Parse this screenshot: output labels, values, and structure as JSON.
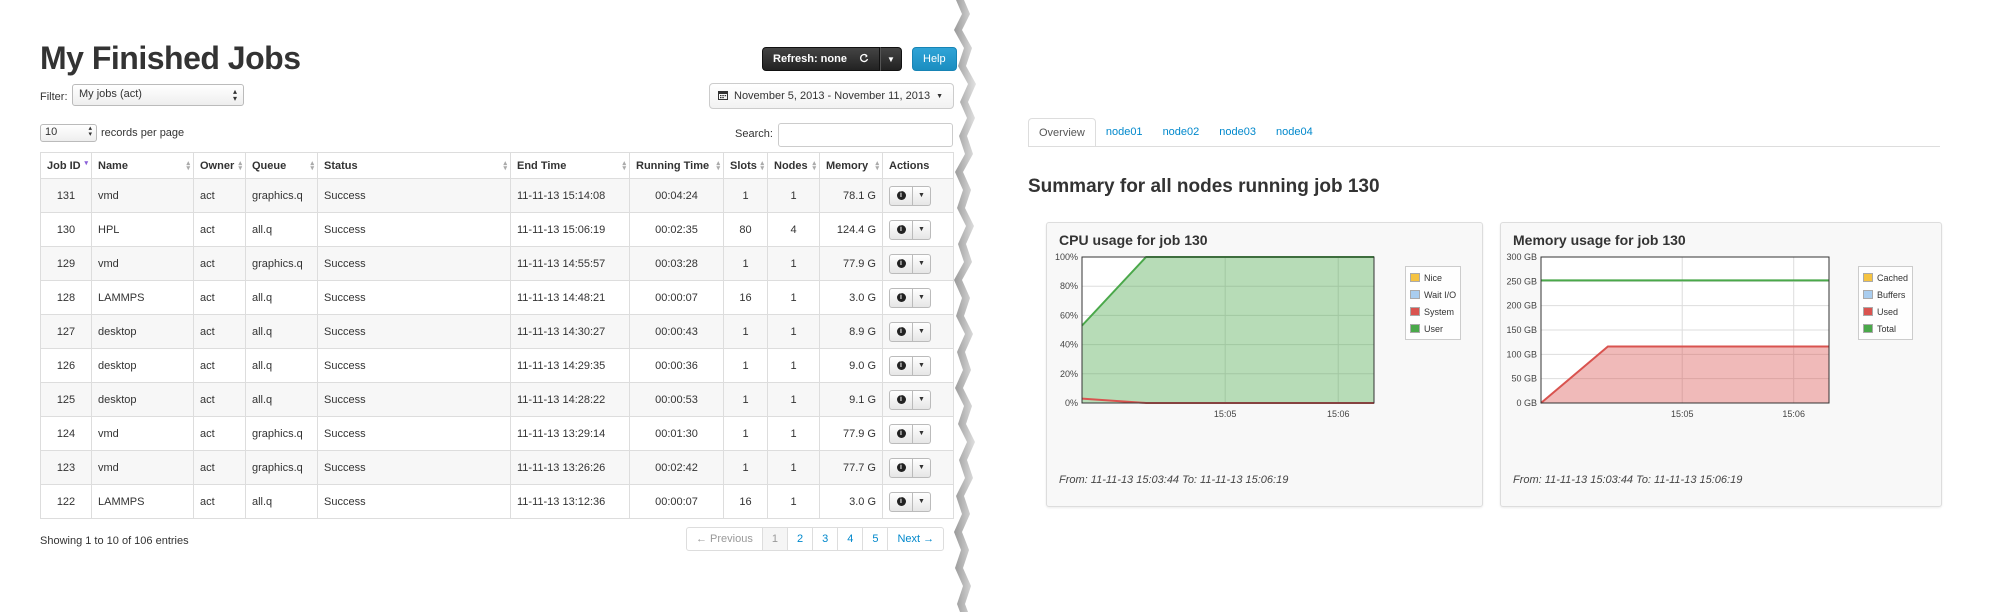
{
  "left": {
    "title": "My Finished Jobs",
    "refresh_label": "Refresh: none",
    "refresh_icon": "refresh-icon",
    "help_label": "Help",
    "filter_label": "Filter:",
    "filter_value": "My jobs (act)",
    "date_range": "November 5, 2013 - November 11, 2013",
    "per_page_value": "10",
    "per_page_label": "records per page",
    "search_label": "Search:",
    "search_value": "",
    "columns": [
      "Job ID",
      "Name",
      "Owner",
      "Queue",
      "Status",
      "End Time",
      "Running Time",
      "Slots",
      "Nodes",
      "Memory",
      "Actions"
    ],
    "rows": [
      {
        "id": "131",
        "name": "vmd",
        "owner": "act",
        "queue": "graphics.q",
        "status": "Success",
        "end": "11-11-13 15:14:08",
        "run": "00:04:24",
        "slots": "1",
        "nodes": "1",
        "mem": "78.1 G"
      },
      {
        "id": "130",
        "name": "HPL",
        "owner": "act",
        "queue": "all.q",
        "status": "Success",
        "end": "11-11-13 15:06:19",
        "run": "00:02:35",
        "slots": "80",
        "nodes": "4",
        "mem": "124.4 G"
      },
      {
        "id": "129",
        "name": "vmd",
        "owner": "act",
        "queue": "graphics.q",
        "status": "Success",
        "end": "11-11-13 14:55:57",
        "run": "00:03:28",
        "slots": "1",
        "nodes": "1",
        "mem": "77.9 G"
      },
      {
        "id": "128",
        "name": "LAMMPS",
        "owner": "act",
        "queue": "all.q",
        "status": "Success",
        "end": "11-11-13 14:48:21",
        "run": "00:00:07",
        "slots": "16",
        "nodes": "1",
        "mem": "3.0 G"
      },
      {
        "id": "127",
        "name": "desktop",
        "owner": "act",
        "queue": "all.q",
        "status": "Success",
        "end": "11-11-13 14:30:27",
        "run": "00:00:43",
        "slots": "1",
        "nodes": "1",
        "mem": "8.9 G"
      },
      {
        "id": "126",
        "name": "desktop",
        "owner": "act",
        "queue": "all.q",
        "status": "Success",
        "end": "11-11-13 14:29:35",
        "run": "00:00:36",
        "slots": "1",
        "nodes": "1",
        "mem": "9.0 G"
      },
      {
        "id": "125",
        "name": "desktop",
        "owner": "act",
        "queue": "all.q",
        "status": "Success",
        "end": "11-11-13 14:28:22",
        "run": "00:00:53",
        "slots": "1",
        "nodes": "1",
        "mem": "9.1 G"
      },
      {
        "id": "124",
        "name": "vmd",
        "owner": "act",
        "queue": "graphics.q",
        "status": "Success",
        "end": "11-11-13 13:29:14",
        "run": "00:01:30",
        "slots": "1",
        "nodes": "1",
        "mem": "77.9 G"
      },
      {
        "id": "123",
        "name": "vmd",
        "owner": "act",
        "queue": "graphics.q",
        "status": "Success",
        "end": "11-11-13 13:26:26",
        "run": "00:02:42",
        "slots": "1",
        "nodes": "1",
        "mem": "77.7 G"
      },
      {
        "id": "122",
        "name": "LAMMPS",
        "owner": "act",
        "queue": "all.q",
        "status": "Success",
        "end": "11-11-13 13:12:36",
        "run": "00:00:07",
        "slots": "16",
        "nodes": "1",
        "mem": "3.0 G"
      }
    ],
    "showing": "Showing 1 to 10 of 106 entries",
    "pager": [
      "← Previous",
      "1",
      "2",
      "3",
      "4",
      "5",
      "Next →"
    ]
  },
  "right": {
    "tabs": [
      "Overview",
      "node01",
      "node02",
      "node03",
      "node04"
    ],
    "summary_title": "Summary for all nodes running job 130",
    "cpu_title": "CPU usage for job 130",
    "cpu_from": "From: 11-11-13 15:03:44 To: 11-11-13 15:06:19",
    "mem_title": "Memory usage for job 130",
    "mem_from": "From: 11-11-13 15:03:44 To: 11-11-13 15:06:19"
  },
  "chart_data": [
    {
      "type": "area",
      "title": "CPU usage for job 130",
      "x": [
        "15:03:44",
        "15:04:18",
        "15:06:19"
      ],
      "x_ticks": [
        "15:05",
        "15:06"
      ],
      "y_ticks": [
        "0%",
        "20%",
        "40%",
        "60%",
        "80%",
        "100%"
      ],
      "ylim": [
        0,
        100
      ],
      "legend": "top-right",
      "series": [
        {
          "name": "Nice",
          "color": "#f5c342",
          "values": [
            0,
            0,
            0
          ]
        },
        {
          "name": "Wait I/O",
          "color": "#a9cdef",
          "values": [
            0,
            0,
            0
          ]
        },
        {
          "name": "System",
          "color": "#d9534f",
          "values": [
            3,
            0,
            0
          ]
        },
        {
          "name": "User",
          "color": "#4aa84a",
          "values": [
            53,
            100,
            100
          ]
        }
      ]
    },
    {
      "type": "area",
      "title": "Memory usage for job 130",
      "x": [
        "15:03:44",
        "15:04:20",
        "15:06:19"
      ],
      "x_ticks": [
        "15:05",
        "15:06"
      ],
      "y_ticks": [
        "0 GB",
        "50 GB",
        "100 GB",
        "150 GB",
        "200 GB",
        "250 GB",
        "300 GB"
      ],
      "ylim": [
        0,
        300
      ],
      "legend": "top-right",
      "series": [
        {
          "name": "Cached",
          "color": "#f5c342",
          "values": [
            0,
            0,
            0
          ]
        },
        {
          "name": "Buffers",
          "color": "#a9cdef",
          "values": [
            0,
            0,
            0
          ]
        },
        {
          "name": "Used",
          "color": "#d9534f",
          "values": [
            0,
            116,
            116
          ]
        },
        {
          "name": "Total",
          "color": "#4aa84a",
          "values": [
            252,
            252,
            252
          ]
        }
      ]
    }
  ]
}
